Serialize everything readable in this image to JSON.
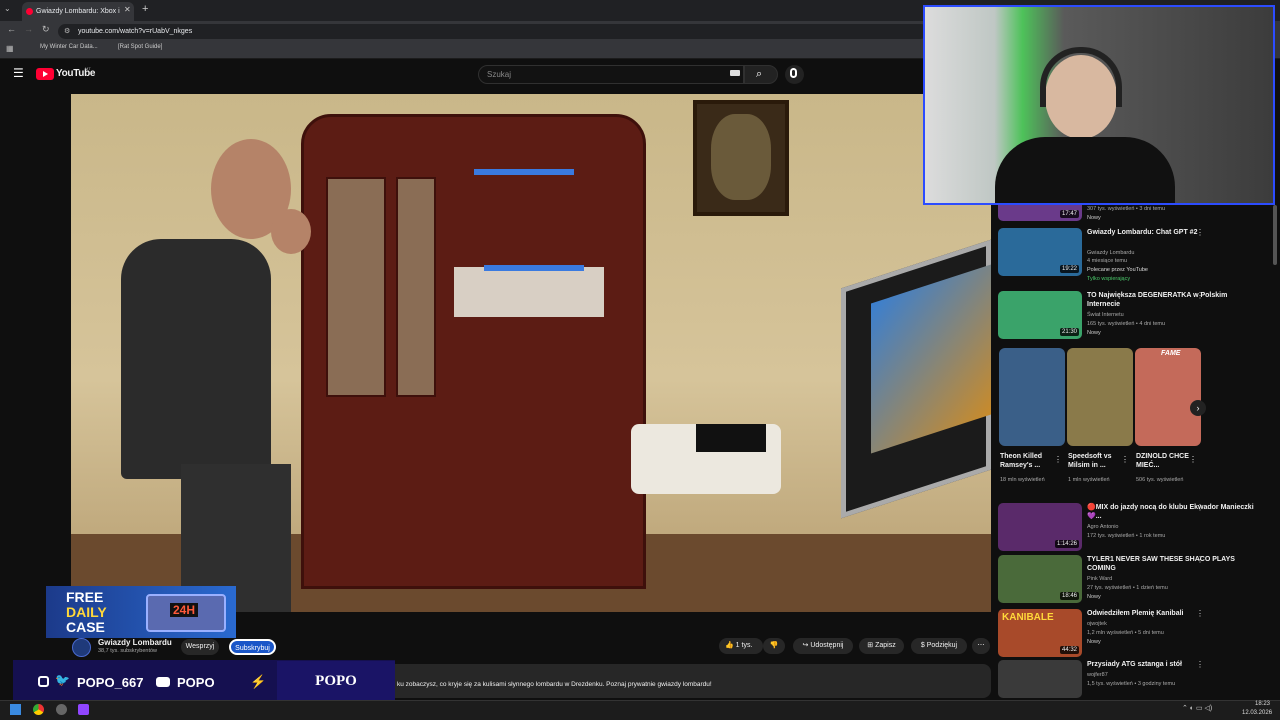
{
  "browser": {
    "tab_title": "Gwiazdy Lombardu: Xbox i",
    "new_tab_glyph": "+",
    "url": "youtube.com/watch?v=rUabV_nkges",
    "bookmarks": [
      "My Winter Car Data...",
      "[Rat Spot Guide]"
    ]
  },
  "youtube": {
    "logo_text": "YouTube",
    "logo_region": "MT",
    "search_placeholder": "Szukaj"
  },
  "channel": {
    "name": "Gwiazdy Lombardu",
    "subscribers": "38,7 tys. subskrybentów",
    "support_label": "Wesprzyj",
    "subscribe_label": "Subskrybuj"
  },
  "actions": {
    "likes": "1 tys.",
    "share": "Udostępnij",
    "save": "Zapisz",
    "thanks": "Podziękuj"
  },
  "description_snippet": "ku zobaczysz, co kryje się za kulisami słynnego lombardu w Drezdenku. Poznaj prywatnie gwiazdy lombardu!",
  "sidebar": {
    "top_partial": {
      "meta": "307 tys. wyświetleń • 3 dni temu",
      "badge": "Nowy",
      "duration": "17:47"
    },
    "videos": [
      {
        "title": "Gwiazdy Lombardu: Chat GPT #2",
        "channel": "Gwiazdy Lombardu",
        "meta": "4 miesiące temu",
        "extra": "Polecane przez YouTube",
        "badge": "Tylko wspierający",
        "duration": "19:22",
        "thumb": "#2a6a9a"
      },
      {
        "title": "TO Największa DEGENERATKA w Polskim Internecie",
        "channel": "Świat Internetu",
        "meta": "165 tys. wyświetleń • 4 dni temu",
        "badge": "Nowy",
        "duration": "21:30",
        "thumb": "#3aa36a"
      }
    ],
    "shorts": [
      {
        "title": "Theon Killed Ramsey's ...",
        "views": "18 mln wyświetleń",
        "thumb": "#3a5f88"
      },
      {
        "title": "Speedsoft vs Milsim in ...",
        "views": "1 mln wyświetleń",
        "thumb": "#8a7a4a"
      },
      {
        "title": "DZINOLD CHCE MIEĆ...",
        "views": "506 tys. wyświetleń",
        "thumb": "#c46a5a",
        "label": "FAME"
      }
    ],
    "videos2": [
      {
        "title": "🔴MIX do jazdy nocą do klubu Ekwador Manieczki 💜...",
        "channel": "Agro Antonio",
        "meta": "172 tys. wyświetleń • 1 rok temu",
        "duration": "1:14:26",
        "thumb": "#5a2a6a"
      },
      {
        "title": "TYLER1 NEVER SAW THESE SHACO PLAYS COMING",
        "channel": "Pink Ward",
        "meta": "27 tys. wyświetleń • 1 dzień temu",
        "badge": "Nowy",
        "duration": "18:46",
        "thumb": "#4a6a3a"
      },
      {
        "title": "Odwiedziłem Plemię Kanibali",
        "channel": "ojwojtek",
        "meta": "1,2 mln wyświetleń • 5 dni temu",
        "badge": "Nowy",
        "duration": "44:32",
        "thumb": "#a84a2a",
        "label": "KANIBALE"
      },
      {
        "title": "Przysiady ATG sztanga i stół",
        "channel": "wojfer87",
        "meta": "1,5 tys. wyświetleń • 3 godziny temu",
        "duration": "",
        "thumb": "#3a3a3a"
      }
    ]
  },
  "overlays": {
    "promo_line1": "FREE",
    "promo_line2": "DAILY",
    "promo_line3": "CASE",
    "promo_badge": "24H",
    "social1": "POPO_667",
    "social2": "POPO",
    "brand": "POPO"
  },
  "taskbar": {
    "time": "18:23",
    "date": "12.03.2026"
  },
  "colors": {
    "accent": "#ff0033",
    "overlay_bg": "#151050",
    "webcam_border": "#2c4cff"
  }
}
